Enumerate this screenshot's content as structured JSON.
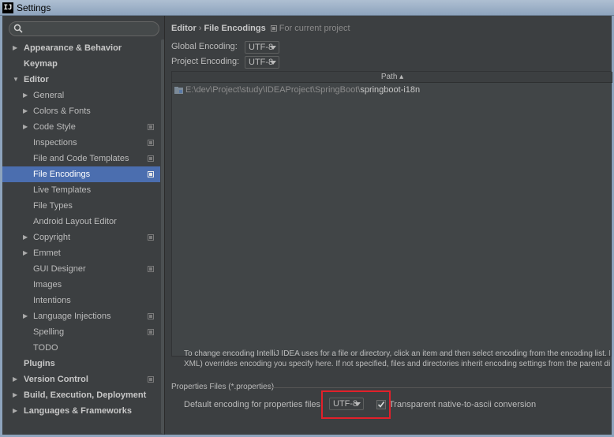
{
  "window": {
    "title": "Settings",
    "app_icon_text": "IJ"
  },
  "sidebar": {
    "items": [
      {
        "label": "Appearance & Behavior",
        "level": 0,
        "arrow": "right",
        "bold": true
      },
      {
        "label": "Keymap",
        "level": 0,
        "arrow": "",
        "bold": true
      },
      {
        "label": "Editor",
        "level": 0,
        "arrow": "down",
        "bold": true
      },
      {
        "label": "General",
        "level": 1,
        "arrow": "right"
      },
      {
        "label": "Colors & Fonts",
        "level": 1,
        "arrow": "right"
      },
      {
        "label": "Code Style",
        "level": 1,
        "arrow": "right",
        "project_icon": true
      },
      {
        "label": "Inspections",
        "level": 1,
        "arrow": "",
        "project_icon": true
      },
      {
        "label": "File and Code Templates",
        "level": 1,
        "arrow": "",
        "project_icon": true
      },
      {
        "label": "File Encodings",
        "level": 1,
        "arrow": "",
        "project_icon": true,
        "selected": true
      },
      {
        "label": "Live Templates",
        "level": 1,
        "arrow": ""
      },
      {
        "label": "File Types",
        "level": 1,
        "arrow": ""
      },
      {
        "label": "Android Layout Editor",
        "level": 1,
        "arrow": ""
      },
      {
        "label": "Copyright",
        "level": 1,
        "arrow": "right",
        "project_icon": true
      },
      {
        "label": "Emmet",
        "level": 1,
        "arrow": "right"
      },
      {
        "label": "GUI Designer",
        "level": 1,
        "arrow": "",
        "project_icon": true
      },
      {
        "label": "Images",
        "level": 1,
        "arrow": ""
      },
      {
        "label": "Intentions",
        "level": 1,
        "arrow": ""
      },
      {
        "label": "Language Injections",
        "level": 1,
        "arrow": "right",
        "project_icon": true
      },
      {
        "label": "Spelling",
        "level": 1,
        "arrow": "",
        "project_icon": true
      },
      {
        "label": "TODO",
        "level": 1,
        "arrow": ""
      },
      {
        "label": "Plugins",
        "level": 0,
        "arrow": "",
        "bold": true
      },
      {
        "label": "Version Control",
        "level": 0,
        "arrow": "right",
        "bold": true,
        "project_icon": true
      },
      {
        "label": "Build, Execution, Deployment",
        "level": 0,
        "arrow": "right",
        "bold": true
      },
      {
        "label": "Languages & Frameworks",
        "level": 0,
        "arrow": "right",
        "bold": true
      }
    ]
  },
  "breadcrumb": {
    "parent": "Editor",
    "separator": "›",
    "current": "File Encodings",
    "scope": "For current project"
  },
  "global_encoding": {
    "label": "Global Encoding:",
    "value": "UTF-8"
  },
  "project_encoding": {
    "label": "Project Encoding:",
    "value": "UTF-8"
  },
  "table": {
    "header": "Path ▴",
    "rows": [
      {
        "path_prefix": "E:\\dev\\Project\\study\\IDEAProject\\SpringBoot\\",
        "path_name": "springboot-i18n"
      }
    ]
  },
  "hint": {
    "line1": "To change encoding IntelliJ IDEA uses for a file or directory, click an item and then select encoding from the encoding list. Built-i",
    "line2": "XML) overrides encoding you specify here. If not specified, files and directories inherit encoding settings from the parent directo"
  },
  "properties": {
    "section_label": "Properties Files (*.properties)",
    "default_label": "Default encoding for properties files:",
    "default_value": "UTF-8",
    "transparent_checked": true,
    "transparent_label": "Transparent native-to-ascii conversion"
  },
  "colors": {
    "selection": "#4b6eaf",
    "highlight_box": "#e2202a",
    "background": "#3c3f41"
  }
}
